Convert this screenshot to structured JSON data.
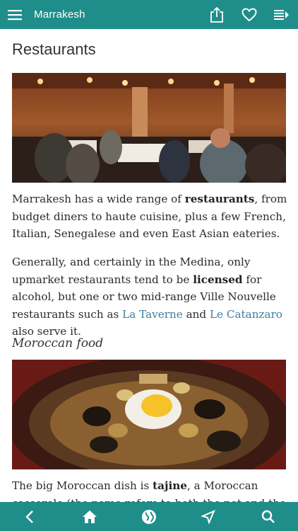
{
  "header": {
    "title": "Marrakesh",
    "menu_icon": "hamburger-menu-icon",
    "share_icon": "share-icon",
    "favorite_icon": "heart-icon",
    "contents_icon": "list-icon"
  },
  "article": {
    "heading": "Restaurants",
    "photo1": "restaurant-dining-hall-photo",
    "para1": {
      "t1": "Marrakesh has a wide range of ",
      "b1": "restaurants",
      "t2": ", from budget diners to haute cuisine, plus a few French, Italian, Senegalese and even East Asian eateries."
    },
    "para2": {
      "t1": "Generally, and certainly in the Medina, only upmarket restaurants tend to be ",
      "b1": "licensed",
      "t2": " for alcohol, but one or two mid-range Ville Nouvelle restaurants such as ",
      "link1": "La Taverne",
      "t3": " and ",
      "link2": "Le Catanzaro",
      "t4": " also serve it."
    },
    "subheading": "Moroccan food",
    "photo2": "tajine-dish-photo",
    "para3": {
      "t1": "The big Moroccan dish is ",
      "b1": "tajine",
      "t2": ", a Moroccan casserole (the name refers to both the pot and the"
    }
  },
  "bottom_nav": {
    "back_icon": "back-chevron-icon",
    "home_icon": "home-icon",
    "globe_icon": "globe-icon",
    "location_icon": "location-arrow-icon",
    "search_icon": "search-icon"
  },
  "colors": {
    "bar": "#1f8e8a",
    "link": "#3d7fa0"
  }
}
